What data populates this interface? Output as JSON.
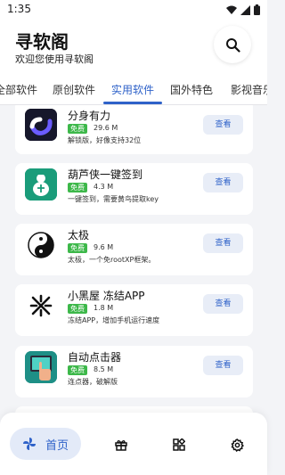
{
  "status_bar": {
    "time": "1:35"
  },
  "header": {
    "title": "寻软阁",
    "subtitle": "欢迎您使用寻软阁"
  },
  "tabs": [
    {
      "label": "全部软件"
    },
    {
      "label": "原创软件"
    },
    {
      "label": "实用软件",
      "active": true
    },
    {
      "label": "国外特色"
    },
    {
      "label": "影视音乐"
    }
  ],
  "apps": [
    {
      "name": "分身有力",
      "badge": "免费",
      "size": "29.6 M",
      "desc": "解锁版，好像支持32位",
      "view_label": "查看",
      "icon": "fenshen-icon"
    },
    {
      "name": "葫芦侠一键签到",
      "badge": "免费",
      "size": "4.3 M",
      "desc": "一键签到，需要黄鸟提取key",
      "view_label": "查看",
      "icon": "huluxia-icon"
    },
    {
      "name": "太极",
      "badge": "免费",
      "size": "9.6 M",
      "desc": "太极，一个免rootXP框架。",
      "view_label": "查看",
      "icon": "taiji-icon"
    },
    {
      "name": "小黑屋 冻结APP",
      "badge": "免费",
      "size": "1.8 M",
      "desc": "冻结APP，增加手机运行速度",
      "view_label": "查看",
      "icon": "xiaoheiwu-icon"
    },
    {
      "name": "自动点击器",
      "badge": "免费",
      "size": "8.5 M",
      "desc": "连点器，破解版",
      "view_label": "查看",
      "icon": "auto-clicker-icon"
    }
  ],
  "bottom_nav": {
    "home_label": "首页",
    "items": [
      "home-icon",
      "gift-icon",
      "apps-grid-icon",
      "settings-icon"
    ]
  },
  "colors": {
    "accent": "#2f62c9",
    "badge_green": "#3db84a",
    "background": "#f3f4f7"
  }
}
